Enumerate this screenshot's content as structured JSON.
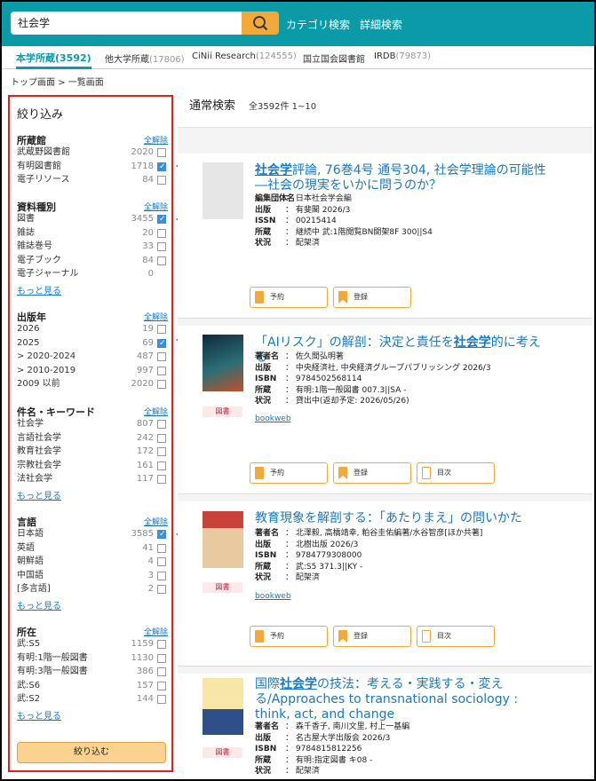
{
  "search": {
    "query": "社会学",
    "category_link": "カテゴリ検索",
    "advanced_link": "詳細検索"
  },
  "tabs": [
    {
      "label": "本学所蔵",
      "count": "(3592)"
    },
    {
      "label": "他大学所蔵",
      "count": "(17806)"
    },
    {
      "label": "CiNii Research",
      "count": "(124555)"
    },
    {
      "label": "国立国会図書館",
      "count": ""
    },
    {
      "label": "IRDB",
      "count": "(79873)"
    }
  ],
  "breadcrumb": "トップ画面 > 一覧画面",
  "filter": {
    "title": "絞り込み",
    "clear": "全解除",
    "more": "もっと見る",
    "apply": "絞り込む",
    "groups": [
      {
        "heading": "所蔵館",
        "items": [
          {
            "label": "武蔵野図書館",
            "count": "2020",
            "checked": false
          },
          {
            "label": "有明図書館",
            "count": "1718",
            "checked": true
          },
          {
            "label": "電子リソース",
            "count": "84",
            "checked": false
          }
        ]
      },
      {
        "heading": "資料種別",
        "items": [
          {
            "label": "図書",
            "count": "3455",
            "checked": true
          },
          {
            "label": "雑誌",
            "count": "20",
            "checked": false
          },
          {
            "label": "雑誌巻号",
            "count": "33",
            "checked": false
          },
          {
            "label": "電子ブック",
            "count": "84",
            "checked": false
          },
          {
            "label": "電子ジャーナル",
            "count": "0",
            "checked": false
          }
        ]
      },
      {
        "heading": "出版年",
        "items": [
          {
            "label": "2026",
            "count": "19",
            "checked": false
          },
          {
            "label": "2025",
            "count": "69",
            "checked": true
          },
          {
            "label": "> 2020-2024",
            "count": "487",
            "checked": false
          },
          {
            "label": "> 2010-2019",
            "count": "997",
            "checked": false
          },
          {
            "label": "2009 以前",
            "count": "2020",
            "checked": false
          }
        ]
      },
      {
        "heading": "件名・キーワード",
        "items": [
          {
            "label": "社会学",
            "count": "807",
            "checked": false
          },
          {
            "label": "言語社会学",
            "count": "242",
            "checked": false
          },
          {
            "label": "教育社会学",
            "count": "172",
            "checked": false
          },
          {
            "label": "宗教社会学",
            "count": "161",
            "checked": false
          },
          {
            "label": "法社会学",
            "count": "117",
            "checked": false
          }
        ]
      },
      {
        "heading": "言語",
        "items": [
          {
            "label": "日本語",
            "count": "3585",
            "checked": true
          },
          {
            "label": "英語",
            "count": "41",
            "checked": false
          },
          {
            "label": "朝鮮語",
            "count": "4",
            "checked": false
          },
          {
            "label": "中国語",
            "count": "3",
            "checked": false
          },
          {
            "label": "[多言語]",
            "count": "2",
            "checked": false
          }
        ]
      },
      {
        "heading": "所在",
        "items": [
          {
            "label": "武:S5",
            "count": "1159",
            "checked": false
          },
          {
            "label": "有明:1階一般図書",
            "count": "1130",
            "checked": false
          },
          {
            "label": "有明:3階一般図書",
            "count": "386",
            "checked": false
          },
          {
            "label": "武:S6",
            "count": "157",
            "checked": false
          },
          {
            "label": "武:S2",
            "count": "144",
            "checked": false
          }
        ]
      }
    ]
  },
  "results": {
    "heading": "通常検索",
    "summary": "全3592件 1~10",
    "records": [
      {
        "title_pre": "",
        "title_hl": "社会学",
        "title_post": "評論, 76巻4号 通号304, 社会学理論の可能性―社会の現実をいかに問うのか？",
        "type": "",
        "meta": [
          [
            "編集団体名",
            "： 日本社会学会編"
          ],
          [
            "出版",
            "： 有斐閣 2026/3"
          ],
          [
            "ISSN",
            "： 00215414"
          ],
          [
            "所蔵",
            "： 継続中 武:1階閲覧BN開架8F 300||S4"
          ],
          [
            "状況",
            "： 配架済"
          ]
        ],
        "link": "",
        "buttons": [
          "予約",
          "登録"
        ]
      },
      {
        "title_pre": "「AIリスク」の解剖：決定と責任を",
        "title_hl": "社会学",
        "title_post": "的に考える",
        "type": "図書",
        "meta": [
          [
            "著者名",
            "： 佐久間弘明著"
          ],
          [
            "出版",
            "： 中央経済社, 中央経済グループパブリッシング 2026/3"
          ],
          [
            "ISBN",
            "： 9784502568114"
          ],
          [
            "所蔵",
            "： 有明:1階一般図書 007.3||SA -"
          ],
          [
            "状況",
            "： 貸出中(返却予定: 2026/05/26)"
          ]
        ],
        "link": "bookweb",
        "buttons": [
          "予約",
          "登録",
          "目次"
        ]
      },
      {
        "title_pre": "教育現象を解剖する：「あたりまえ」の問いかた",
        "title_hl": "",
        "title_post": "",
        "type": "図書",
        "meta": [
          [
            "著者名",
            "： 北澤毅, 高橋靖幸, 粕谷圭佑編著/水谷智彦[ほか共著]"
          ],
          [
            "出版",
            "： 北樹出版 2026/3"
          ],
          [
            "ISBN",
            "： 9784779308000"
          ],
          [
            "所蔵",
            "： 武:S5 371.3||KY -"
          ],
          [
            "状況",
            "： 配架済"
          ]
        ],
        "link": "bookweb",
        "buttons": [
          "予約",
          "登録",
          "目次"
        ]
      },
      {
        "title_pre": "国際",
        "title_hl": "社会学",
        "title_post": "の技法：考える・実践する・変える/Approaches to transnational sociology : think, act, and change",
        "type": "図書",
        "meta": [
          [
            "著者名",
            "： 森千香子, 南川文里, 村上一基編"
          ],
          [
            "出版",
            "： 名古屋大学出版会 2026/3"
          ],
          [
            "ISBN",
            "： 9784815812256"
          ],
          [
            "所蔵",
            "： 有明:指定図書 キ08 -"
          ],
          [
            "状況",
            "： 配架済"
          ]
        ],
        "link": "",
        "buttons": []
      }
    ]
  },
  "colors": {
    "brand": "#0b9aa7",
    "accent": "#f3a83a",
    "highlight": "#e02020",
    "link": "#1a78c2"
  }
}
